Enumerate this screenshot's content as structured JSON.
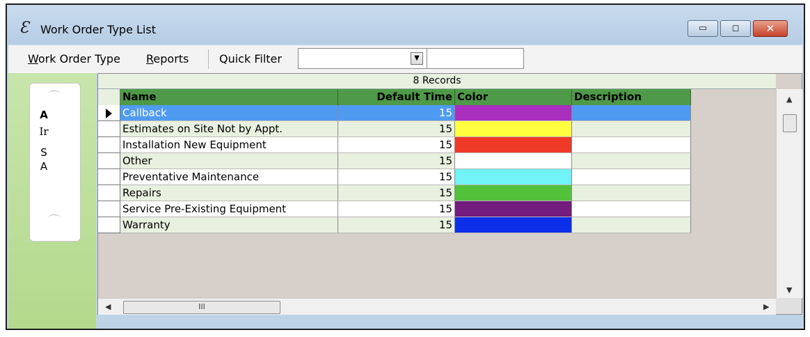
{
  "window": {
    "title": "Work Order Type List",
    "controls": {
      "minimize": "▭",
      "maximize": "◻",
      "close": "✕"
    }
  },
  "menu": {
    "work_order_type": "Work Order Type",
    "reports": "Reports",
    "quick_filter_label": "Quick Filter",
    "quick_filter_value": "",
    "quick_filter_text": ""
  },
  "sidebar": {
    "letters": [
      "A",
      "Ir",
      "S",
      "A"
    ]
  },
  "grid": {
    "records_label": "8 Records",
    "columns": [
      "Name",
      "Default Time",
      "Color",
      "Description"
    ],
    "rows": [
      {
        "name": "Callback",
        "default_time": "15",
        "color": "#a92fbf",
        "description": "",
        "selected": true
      },
      {
        "name": "Estimates on Site Not by Appt.",
        "default_time": "15",
        "color": "#ffff40",
        "description": ""
      },
      {
        "name": "Installation New Equipment",
        "default_time": "15",
        "color": "#ef3a27",
        "description": ""
      },
      {
        "name": "Other",
        "default_time": "15",
        "color": "#ffffff",
        "description": ""
      },
      {
        "name": "Preventative Maintenance",
        "default_time": "15",
        "color": "#6ff3f6",
        "description": ""
      },
      {
        "name": "Repairs",
        "default_time": "15",
        "color": "#53c13a",
        "description": ""
      },
      {
        "name": "Service Pre-Existing Equipment",
        "default_time": "15",
        "color": "#741b7e",
        "description": ""
      },
      {
        "name": "Warranty",
        "default_time": "15",
        "color": "#0b2fe8",
        "description": ""
      }
    ],
    "row_colors": {
      "selected": "#4f9bf2",
      "alt": "#e8f1e0",
      "plain": "#ffffff"
    },
    "hscroll_thumb": "III"
  }
}
